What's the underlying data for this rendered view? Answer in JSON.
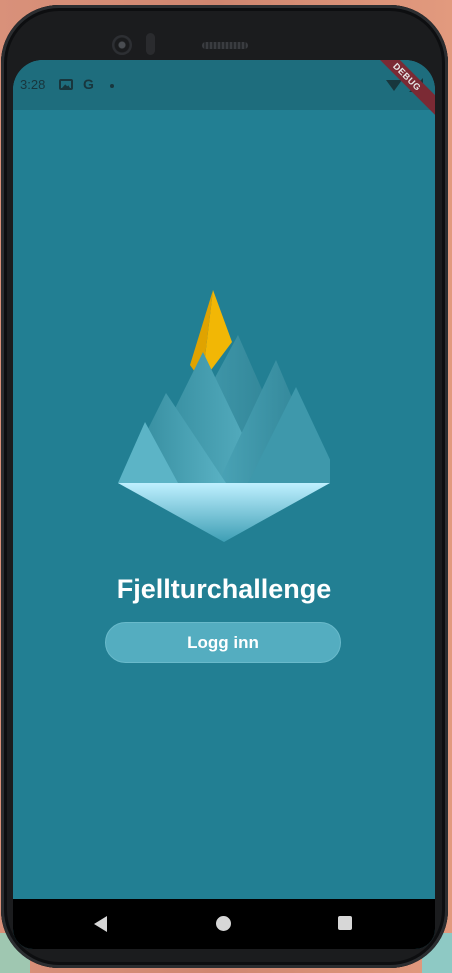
{
  "status_bar": {
    "time": "3:28",
    "icons": [
      "photo-icon",
      "google-icon",
      "dot-icon",
      "wifi-icon",
      "signal-icon"
    ]
  },
  "debug_banner": "DEBUG",
  "main": {
    "logo": "mountain-logo",
    "title": "Fjellturchallenge",
    "login_label": "Logg inn"
  },
  "nav_bar": {
    "icons": [
      "back-icon",
      "home-icon",
      "recents-icon"
    ]
  },
  "colors": {
    "background": "#227f93",
    "status_bar": "#1e6d7d",
    "button": "#54adc0",
    "accent": "#f2b705"
  }
}
